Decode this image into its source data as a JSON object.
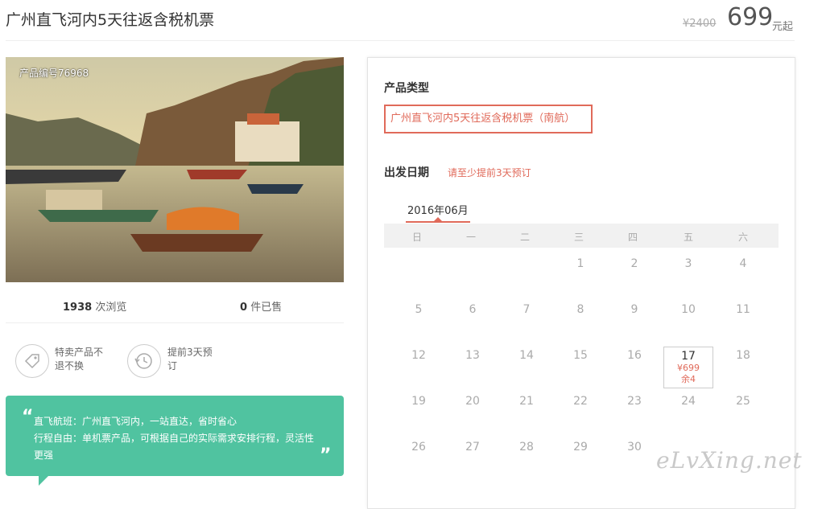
{
  "header": {
    "title": "广州直飞河内5天往返含税机票",
    "old_price": "¥2400",
    "price": "699",
    "price_unit": "元起"
  },
  "photo": {
    "product_code": "产品编号76968"
  },
  "stats": {
    "views_value": "1938",
    "views_label": "次浏览",
    "sold_value": "0",
    "sold_label": "件已售"
  },
  "features": [
    {
      "icon": "tag-icon",
      "line1": "特卖产品不",
      "line2": "退不换"
    },
    {
      "icon": "clock-history-icon",
      "line1": "提前3天预",
      "line2": "订"
    }
  ],
  "highlight": {
    "open_quote": "“",
    "close_quote": "”",
    "line1": "直飞航班：广州直飞河内，一站直达，省时省心",
    "line2": "行程自由：单机票产品，可根据自己的实际需求安排行程，灵活性",
    "line3": "更强"
  },
  "booking": {
    "product_type_title": "产品类型",
    "product_type_option": "广州直飞河内5天往返含税机票（南航）",
    "date_title": "出发日期",
    "date_hint": "请至少提前3天预订",
    "month": "2016年06月",
    "weekdays": [
      "日",
      "一",
      "二",
      "三",
      "四",
      "五",
      "六"
    ],
    "days": [
      "1",
      "2",
      "3",
      "4",
      "5",
      "6",
      "7",
      "8",
      "9",
      "10",
      "11",
      "12",
      "13",
      "14",
      "15",
      "16",
      "17",
      "18",
      "19",
      "20",
      "21",
      "22",
      "23",
      "24",
      "25",
      "26",
      "27",
      "28",
      "29",
      "30"
    ],
    "available_day": {
      "day": "17",
      "price": "¥699",
      "remaining": "余4"
    }
  },
  "watermark": "eLvXing.net",
  "colors": {
    "accent": "#e06a5a",
    "green": "#50c3a0"
  }
}
